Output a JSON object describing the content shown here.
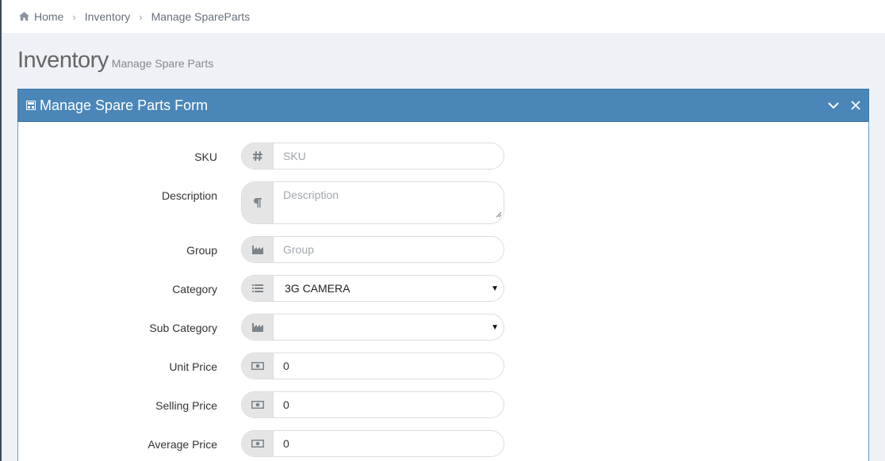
{
  "breadcrumb": {
    "items": [
      "Home",
      "Inventory",
      "Manage SpareParts"
    ]
  },
  "header": {
    "title": "Inventory",
    "subtitle": "Manage Spare Parts"
  },
  "portlet": {
    "title": "Manage Spare Parts Form",
    "header_color": "#4a86b8"
  },
  "form": {
    "sku": {
      "label": "SKU",
      "placeholder": "SKU",
      "value": "",
      "icon": "hash-icon"
    },
    "description": {
      "label": "Description",
      "placeholder": "Description",
      "value": "",
      "icon": "paragraph-icon"
    },
    "group": {
      "label": "Group",
      "placeholder": "Group",
      "value": "",
      "icon": "industry-icon"
    },
    "category": {
      "label": "Category",
      "value": "3G CAMERA",
      "icon": "list-icon"
    },
    "sub_category": {
      "label": "Sub Category",
      "value": "",
      "icon": "industry-icon"
    },
    "unit_price": {
      "label": "Unit Price",
      "value": "0",
      "icon": "money-icon"
    },
    "selling_price": {
      "label": "Selling Price",
      "value": "0",
      "icon": "money-icon"
    },
    "average_price": {
      "label": "Average Price",
      "value": "0",
      "icon": "money-icon"
    }
  }
}
